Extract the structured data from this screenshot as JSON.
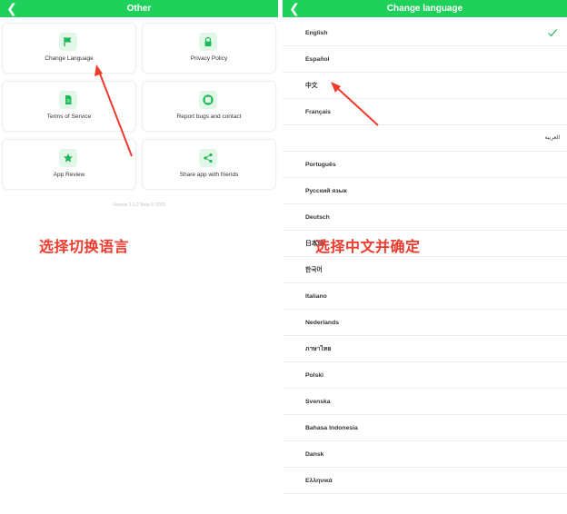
{
  "left_screen": {
    "header_title": "Other",
    "tiles": [
      {
        "label": "Change Language",
        "icon": "flag-icon"
      },
      {
        "label": "Privacy Policy",
        "icon": "lock-icon"
      },
      {
        "label": "Terms of Service",
        "icon": "document-icon"
      },
      {
        "label": "Report bugs and contact",
        "icon": "support-icon"
      },
      {
        "label": "App Review",
        "icon": "star-icon"
      },
      {
        "label": "Share app with friends",
        "icon": "share-icon"
      }
    ],
    "version": "Version 1.2.2 Beta © 2021",
    "annotation": "选择切换语言"
  },
  "right_screen": {
    "header_title": "Change language",
    "selected": "English",
    "languages": [
      "English",
      "Español",
      "中文",
      "Français",
      "العربية",
      "Português",
      "Русский язык",
      "Deutsch",
      "日本語",
      "한국어",
      "Italiano",
      "Nederlands",
      "ภาษาไทย",
      "Polski",
      "Svenska",
      "Bahasa Indonesia",
      "Dansk",
      "Ελληνικά"
    ],
    "annotation": "选择中文并确定"
  },
  "colors": {
    "header_green": "#1fd05b",
    "icon_bg": "#e3f6ea",
    "icon_green": "#1db954",
    "annotation_red": "#ef3a2c"
  }
}
